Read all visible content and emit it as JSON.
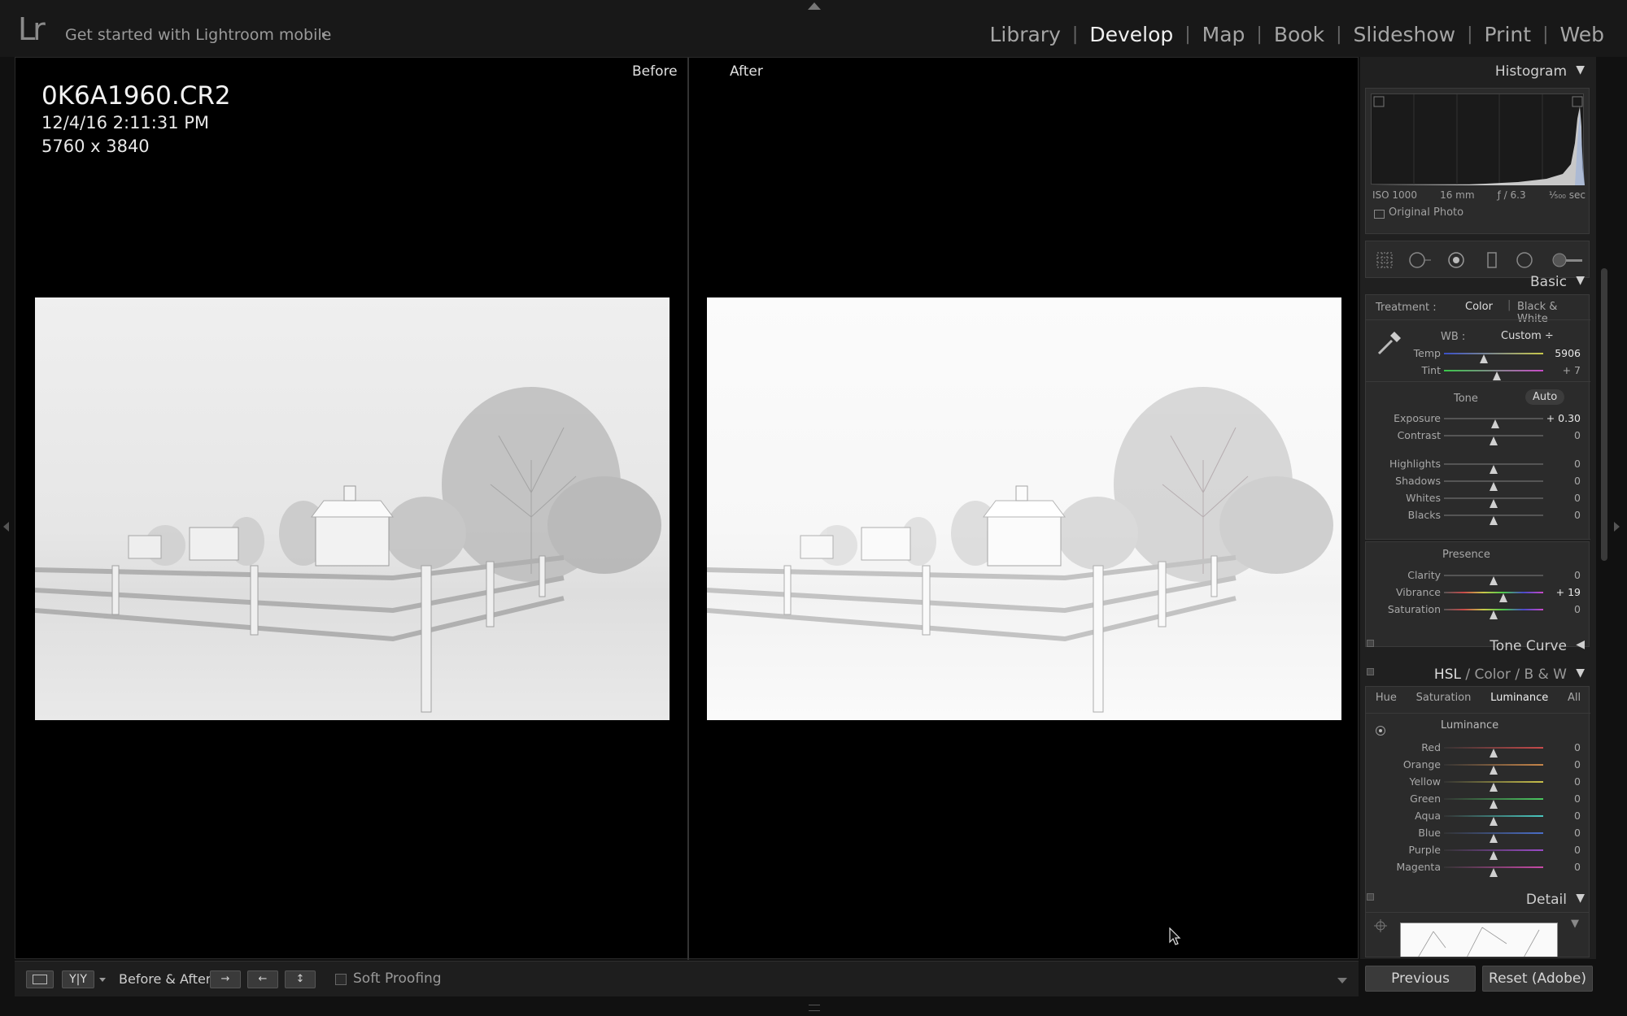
{
  "topbar": {
    "logo": "Lr",
    "mobile_text": "Get started with Lightroom mobile",
    "mobile_arrow": "▸",
    "modules": [
      {
        "label": "Library",
        "active": false
      },
      {
        "label": "Develop",
        "active": true
      },
      {
        "label": "Map",
        "active": false
      },
      {
        "label": "Book",
        "active": false
      },
      {
        "label": "Slideshow",
        "active": false
      },
      {
        "label": "Print",
        "active": false
      },
      {
        "label": "Web",
        "active": false
      }
    ]
  },
  "viewer": {
    "filename": "0K6A1960.CR2",
    "datetime": "12/4/16 2:11:31 PM",
    "dimensions": "5760 x 3840",
    "before_label": "Before",
    "after_label": "After"
  },
  "toolbar": {
    "yy_label": "Y|Y",
    "before_after_label": "Before & After :",
    "soft_proofing_label": "Soft Proofing",
    "swap_icons": [
      "arrow-right-icon",
      "arrow-left-icon",
      "swap-vertical-icon"
    ]
  },
  "histogram": {
    "title": "Histogram",
    "iso": "ISO 1000",
    "focal": "16 mm",
    "aperture": "ƒ / 6.3",
    "shutter": "¹⁄₅₀₀ sec",
    "original_photo": "Original Photo"
  },
  "basic": {
    "title": "Basic",
    "treatment_label": "Treatment :",
    "treatment_color": "Color",
    "treatment_bw": "Black & White",
    "wb_label": "WB :",
    "wb_value": "Custom ÷",
    "tone_label": "Tone",
    "auto_label": "Auto",
    "presence_label": "Presence",
    "wb_sliders": [
      {
        "name": "Temp",
        "value": "5906",
        "pos": 0.4,
        "highlight": true
      },
      {
        "name": "Tint",
        "value": "+ 7",
        "pos": 0.53,
        "highlight": false
      }
    ],
    "tone_sliders": [
      {
        "name": "Exposure",
        "value": "+ 0.30",
        "pos": 0.52,
        "highlight": true
      },
      {
        "name": "Contrast",
        "value": "0",
        "pos": 0.5,
        "highlight": false
      },
      {
        "name": "Highlights",
        "value": "0",
        "pos": 0.5,
        "highlight": false
      },
      {
        "name": "Shadows",
        "value": "0",
        "pos": 0.5,
        "highlight": false
      },
      {
        "name": "Whites",
        "value": "0",
        "pos": 0.5,
        "highlight": false
      },
      {
        "name": "Blacks",
        "value": "0",
        "pos": 0.5,
        "highlight": false
      }
    ],
    "presence_sliders": [
      {
        "name": "Clarity",
        "value": "0",
        "pos": 0.5,
        "highlight": false
      },
      {
        "name": "Vibrance",
        "value": "+ 19",
        "pos": 0.6,
        "highlight": true
      },
      {
        "name": "Saturation",
        "value": "0",
        "pos": 0.5,
        "highlight": false
      }
    ]
  },
  "tone_curve": {
    "title": "Tone Curve"
  },
  "hsl": {
    "title_hsl": "HSL",
    "title_color": "Color",
    "title_bw": "B & W",
    "tabs": [
      "Hue",
      "Saturation",
      "Luminance",
      "All"
    ],
    "active_tab": "Luminance",
    "section_label": "Luminance",
    "sliders": [
      {
        "name": "Red",
        "value": "0",
        "pos": 0.5,
        "color": "#c84a4a"
      },
      {
        "name": "Orange",
        "value": "0",
        "pos": 0.5,
        "color": "#c8864a"
      },
      {
        "name": "Yellow",
        "value": "0",
        "pos": 0.5,
        "color": "#c8c04a"
      },
      {
        "name": "Green",
        "value": "0",
        "pos": 0.5,
        "color": "#4ac860"
      },
      {
        "name": "Aqua",
        "value": "0",
        "pos": 0.5,
        "color": "#4ac8c0"
      },
      {
        "name": "Blue",
        "value": "0",
        "pos": 0.5,
        "color": "#4a6ec8"
      },
      {
        "name": "Purple",
        "value": "0",
        "pos": 0.5,
        "color": "#9a4ac8"
      },
      {
        "name": "Magenta",
        "value": "0",
        "pos": 0.5,
        "color": "#c84aa8"
      }
    ]
  },
  "detail": {
    "title": "Detail"
  },
  "footer": {
    "previous_label": "Previous",
    "reset_label": "Reset (Adobe)"
  }
}
